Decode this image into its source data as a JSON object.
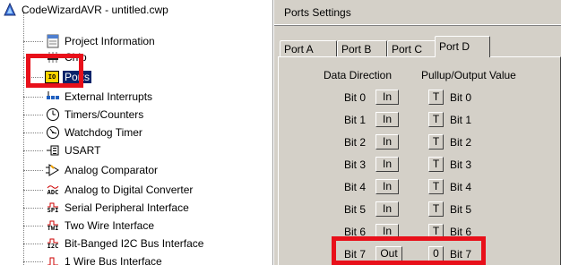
{
  "tree": {
    "root_label": "CodeWizardAVR - untitled.cwp",
    "items": [
      {
        "label": "Project Information",
        "icon": "document-icon"
      },
      {
        "label": "Chip",
        "icon": "chip-icon"
      },
      {
        "label": "Ports",
        "icon": "io-ports-icon",
        "selected": true,
        "icon_text": "IO"
      },
      {
        "label": "External Interrupts",
        "icon": "interrupt-icon"
      },
      {
        "label": "Timers/Counters",
        "icon": "clock-icon"
      },
      {
        "label": "Watchdog Timer",
        "icon": "watchdog-clock-icon"
      },
      {
        "label": "USART",
        "icon": "usart-icon"
      },
      {
        "label": "Analog Comparator",
        "icon": "comparator-icon"
      },
      {
        "label": "Analog to Digital Converter",
        "icon": "adc-icon",
        "icon_text": "ADC"
      },
      {
        "label": "Serial Peripheral Interface",
        "icon": "spi-icon",
        "icon_text": "SPI"
      },
      {
        "label": "Two Wire Interface",
        "icon": "twi-icon",
        "icon_text": "TWI"
      },
      {
        "label": "Bit-Banged I2C Bus Interface",
        "icon": "i2c-icon",
        "icon_text": "I2C"
      },
      {
        "label": "1 Wire Bus Interface",
        "icon": "one-wire-icon"
      }
    ]
  },
  "panel": {
    "title": "Ports Settings",
    "tabs": [
      "Port A",
      "Port B",
      "Port C",
      "Port D"
    ],
    "active_tab": "Port D",
    "col_direction": "Data Direction",
    "col_value": "Pullup/Output Value",
    "bits": [
      {
        "bit": "Bit 0",
        "dir": "In",
        "val": "T",
        "vbit": "Bit 0"
      },
      {
        "bit": "Bit 1",
        "dir": "In",
        "val": "T",
        "vbit": "Bit 1"
      },
      {
        "bit": "Bit 2",
        "dir": "In",
        "val": "T",
        "vbit": "Bit 2"
      },
      {
        "bit": "Bit 3",
        "dir": "In",
        "val": "T",
        "vbit": "Bit 3"
      },
      {
        "bit": "Bit 4",
        "dir": "In",
        "val": "T",
        "vbit": "Bit 4"
      },
      {
        "bit": "Bit 5",
        "dir": "In",
        "val": "T",
        "vbit": "Bit 5"
      },
      {
        "bit": "Bit 6",
        "dir": "In",
        "val": "T",
        "vbit": "Bit 6"
      },
      {
        "bit": "Bit 7",
        "dir": "Out",
        "val": "0",
        "vbit": "Bit 7"
      }
    ]
  },
  "colors": {
    "highlight": "#e8101a",
    "selection": "#0a246a",
    "face": "#d4d0c8"
  }
}
